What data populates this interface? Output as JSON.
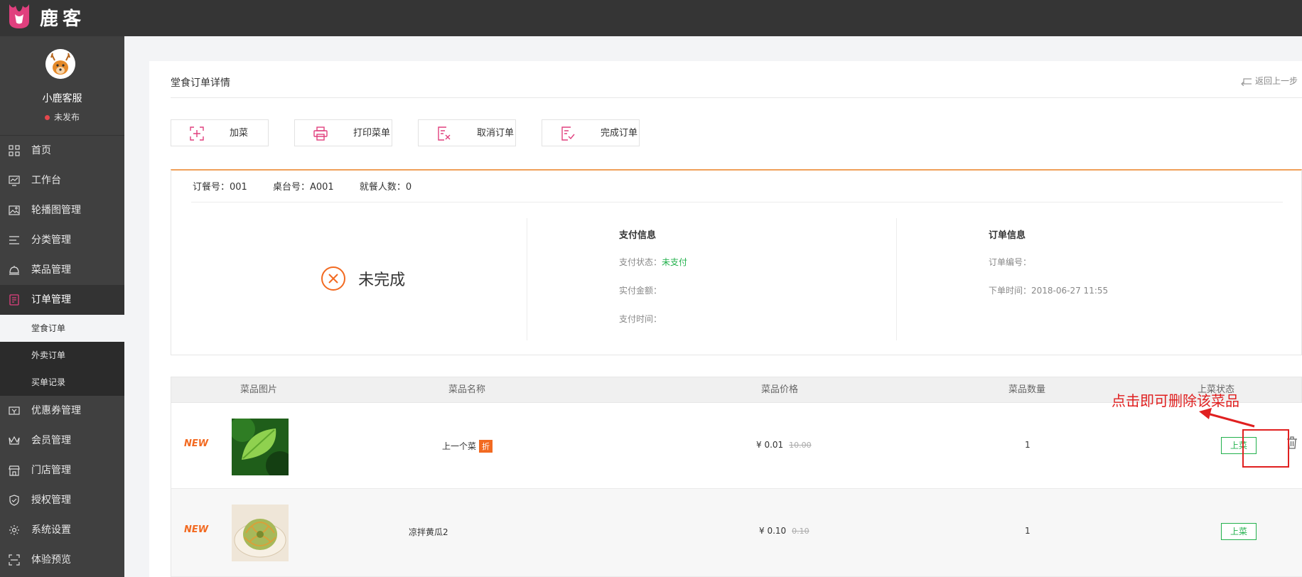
{
  "app": {
    "brand": "鹿客"
  },
  "user": {
    "name": "小鹿客服",
    "status": "未发布"
  },
  "sidebar": {
    "items": [
      {
        "label": "首页",
        "icon": "grid-icon"
      },
      {
        "label": "工作台",
        "icon": "monitor-chart-icon"
      },
      {
        "label": "轮播图管理",
        "icon": "image-icon"
      },
      {
        "label": "分类管理",
        "icon": "list-icon"
      },
      {
        "label": "菜品管理",
        "icon": "cloche-icon"
      },
      {
        "label": "订单管理",
        "icon": "order-icon"
      }
    ],
    "sub_items": [
      {
        "label": "堂食订单"
      },
      {
        "label": "外卖订单"
      },
      {
        "label": "买单记录"
      }
    ],
    "items_after": [
      {
        "label": "优惠券管理",
        "icon": "coupon-icon"
      },
      {
        "label": "会员管理",
        "icon": "crown-icon"
      },
      {
        "label": "门店管理",
        "icon": "store-icon"
      },
      {
        "label": "授权管理",
        "icon": "shield-icon"
      },
      {
        "label": "系统设置",
        "icon": "gear-icon"
      },
      {
        "label": "体验预览",
        "icon": "scan-icon"
      }
    ]
  },
  "page": {
    "title": "堂食订单详情",
    "back_label": "返回上一步"
  },
  "actions": [
    {
      "label": "加菜",
      "icon": "add-dish-icon"
    },
    {
      "label": "打印菜单",
      "icon": "printer-icon"
    },
    {
      "label": "取消订单",
      "icon": "cancel-order-icon"
    },
    {
      "label": "完成订单",
      "icon": "complete-order-icon"
    }
  ],
  "order": {
    "number": "订餐号：001",
    "table": "桌台号：A001",
    "guests": "就餐人数：0",
    "status": "未完成"
  },
  "payment": {
    "title": "支付信息",
    "status_label": "支付状态：",
    "status_value": "未支付",
    "amount_label": "实付金额：",
    "time_label": "支付时间："
  },
  "order_info": {
    "title": "订单信息",
    "id_label": "订单编号：",
    "time_label": "下单时间：2018-06-27 11:55"
  },
  "table": {
    "headers": [
      "菜品图片",
      "菜品名称",
      "菜品价格",
      "菜品数量",
      "上菜状态"
    ],
    "rows": [
      {
        "badge": "NEW",
        "name": "上一个菜",
        "discount_tag": "折",
        "price": "¥ 0.01",
        "old_price": "10.00",
        "qty": "1",
        "serve_label": "上菜"
      },
      {
        "badge": "NEW",
        "name": "凉拌黄瓜2",
        "discount_tag": "",
        "price": "¥ 0.10",
        "old_price": "0.10",
        "qty": "1",
        "serve_label": "上菜"
      }
    ]
  },
  "annotation": {
    "text": "点击即可删除该菜品",
    "color": "#e02020"
  },
  "colors": {
    "accent": "#e0407e",
    "orange": "#f26a21",
    "green": "#22b14c",
    "sidebar_bg": "#404040",
    "topbar_bg": "#353535"
  }
}
